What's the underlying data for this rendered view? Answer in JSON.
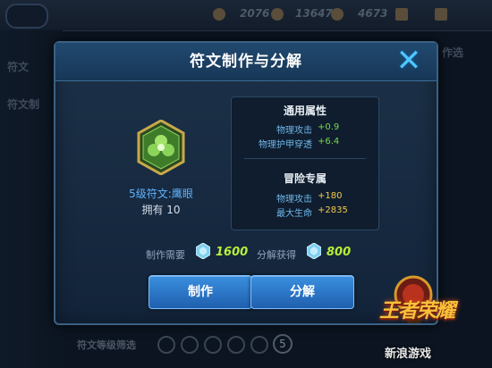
{
  "background": {
    "stats": [
      "2076",
      "13647",
      "4673"
    ],
    "tabs": [
      "符文",
      "符文制"
    ],
    "right_label": "作选",
    "bottom_label": "符文等级筛选",
    "level_badge": "5"
  },
  "dialog": {
    "title": "符文制作与分解",
    "close_icon": "close-icon",
    "rune": {
      "icon": "rune-hexagon-icon",
      "name": "5级符文:鹰眼",
      "owned": "拥有 10"
    },
    "general_attributes": {
      "heading": "通用属性",
      "items": [
        {
          "label": "物理攻击",
          "value": "+0.9"
        },
        {
          "label": "物理护甲穿透",
          "value": "+6.4"
        }
      ]
    },
    "adventure_attributes": {
      "heading": "冒险专属",
      "items": [
        {
          "label": "物理攻击",
          "value": "+180"
        },
        {
          "label": "最大生命",
          "value": "+2835"
        }
      ]
    },
    "costs": {
      "craft_label": "制作需要",
      "craft_value": "1600",
      "decompose_label": "分解获得",
      "decompose_value": "800",
      "currency_icon": "crystal-icon"
    },
    "buttons": {
      "craft": "制作",
      "decompose": "分解"
    }
  },
  "watermark": {
    "game_logo": "王者荣耀",
    "source": "新浪游戏"
  },
  "colors": {
    "dialog_bg": "#13243a",
    "accent_blue": "#4fc6ff",
    "attr_green": "#79d94a",
    "attr_gold": "#f1c94c",
    "cost_green": "#b7f03a",
    "button_blue": "#2a76c8"
  }
}
